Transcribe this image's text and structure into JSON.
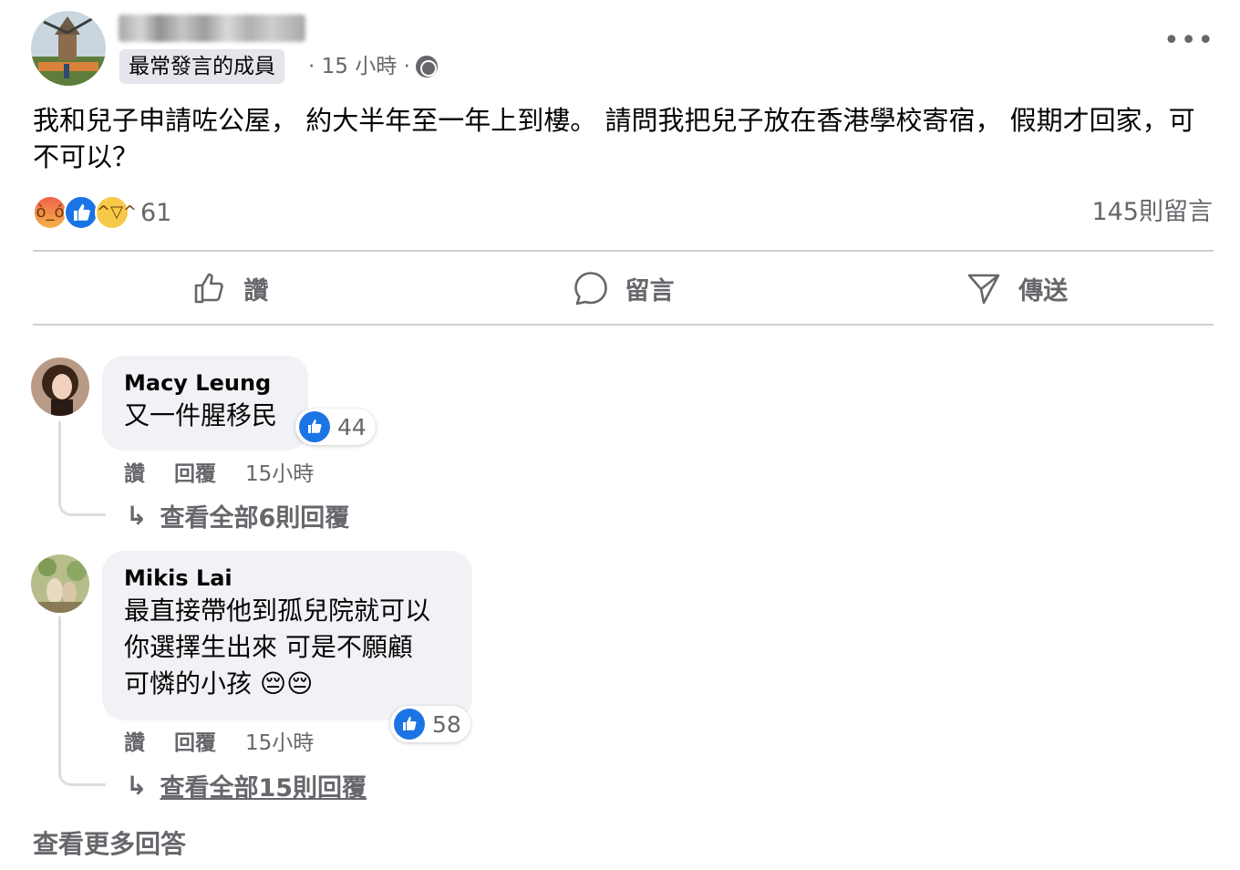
{
  "post": {
    "badge": "最常發言的成員",
    "meta_time": "· 15 小時 ·",
    "text": "我和兒子申請咗公屋， 約大半年至一年上到樓。 請問我把兒子放在香港學校寄宿， 假期才回家，可不可以？",
    "reaction_count": "61",
    "reaction_types": [
      "angry-icon",
      "like-icon",
      "haha-icon"
    ],
    "comment_count": "145則留言"
  },
  "actions": {
    "like": "讚",
    "comment": "留言",
    "send": "傳送"
  },
  "comments": [
    {
      "name": "Macy Leung",
      "lines": [
        "又一件腥移民"
      ],
      "likes": "44",
      "like_label": "讚",
      "reply_label": "回覆",
      "time": "15小時",
      "view_replies": "查看全部6則回覆"
    },
    {
      "name": "Mikis Lai",
      "lines": [
        "最直接帶他到孤兒院就可以",
        "你選擇生出來 可是不願顧",
        "可憐的小孩 😔😔"
      ],
      "likes": "58",
      "like_label": "讚",
      "reply_label": "回覆",
      "time": "15小時",
      "view_replies": "查看全部15則回覆"
    }
  ],
  "view_more": "查看更多回答",
  "colors": {
    "accent": "#1b74e4",
    "secondary_text": "#65676b",
    "bubble": "#f0f2f5"
  }
}
